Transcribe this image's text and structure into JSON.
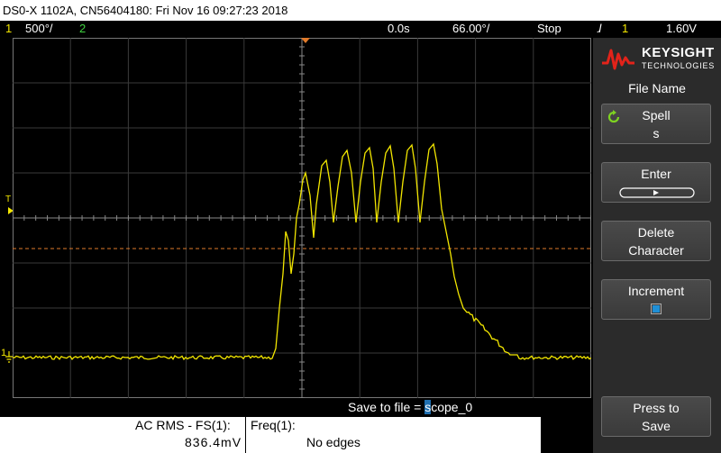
{
  "title": "DS0-X 1102A, CN56404180: Fri Nov 16 09:27:23 2018",
  "status": {
    "ch1_num": "1",
    "ch1_scale": "500°/",
    "ch2_num": "2",
    "time_offset": "0.0s",
    "time_scale": "66.00°/",
    "run_state": "Stop",
    "trigger_icon": "ɺ",
    "trigger_source": "1",
    "trigger_level": "1.60V"
  },
  "markers": {
    "trigger_marker": "T",
    "ground_marker": "1"
  },
  "softkeys": {
    "menu_title": "File Name",
    "spell_label": "Spell",
    "spell_value": "s",
    "enter_label": "Enter",
    "delete_label1": "Delete",
    "delete_label2": "Character",
    "increment_label": "Increment",
    "press_label1": "Press to",
    "press_label2": "Save"
  },
  "logo": {
    "brand": "KEYSIGHT",
    "sub": "TECHNOLOGIES"
  },
  "save": {
    "prefix": "Save to file = ",
    "cursor_char": "s",
    "rest": "cope_0"
  },
  "measurements": {
    "m1_label": "AC RMS - FS(1):",
    "m1_value": "836.4mV",
    "m2_label": "Freq(1):",
    "m2_value": "No edges"
  },
  "colors": {
    "ch1": "#f2e600",
    "ch2": "#3fd13f",
    "trigger_level_line": "#e07a2a",
    "accent": "#1f6fb0"
  }
}
